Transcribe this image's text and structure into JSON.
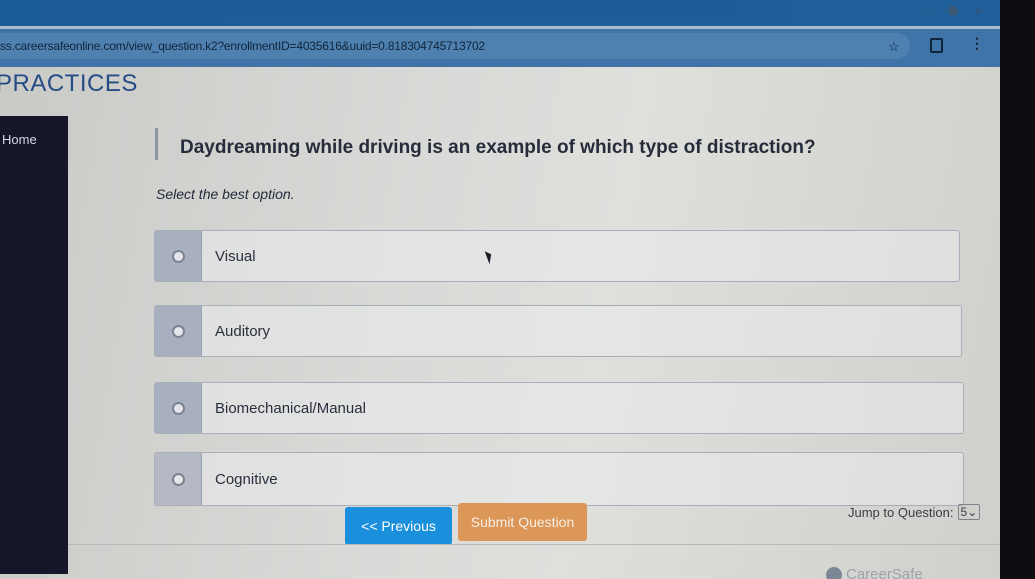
{
  "browser": {
    "url": "ss.careersafeonline.com/view_question.k2?enrollmentID=4035616&uuid=0.818304745713702",
    "window_controls": [
      "minimize",
      "profile",
      "close"
    ]
  },
  "site": {
    "title": "PRACTICES",
    "sidebar": {
      "home_label": "Home"
    }
  },
  "quiz": {
    "question": "Daydreaming while driving is an example of which type of distraction?",
    "instruction": "Select the best option.",
    "options": [
      {
        "label": "Visual",
        "selected": false
      },
      {
        "label": "Auditory",
        "selected": false
      },
      {
        "label": "Biomechanical/Manual",
        "selected": false
      },
      {
        "label": "Cognitive",
        "selected": false
      }
    ],
    "buttons": {
      "previous": "<< Previous",
      "submit": "Submit Question"
    },
    "jump": {
      "label": "Jump to Question:",
      "selected": "5"
    }
  },
  "footer": {
    "brand": "CareerSafe"
  },
  "colors": {
    "previous_button": "#1a8fdc",
    "submit_button": "#db9658",
    "title": "#264c86",
    "sidebar": "#16162a"
  }
}
